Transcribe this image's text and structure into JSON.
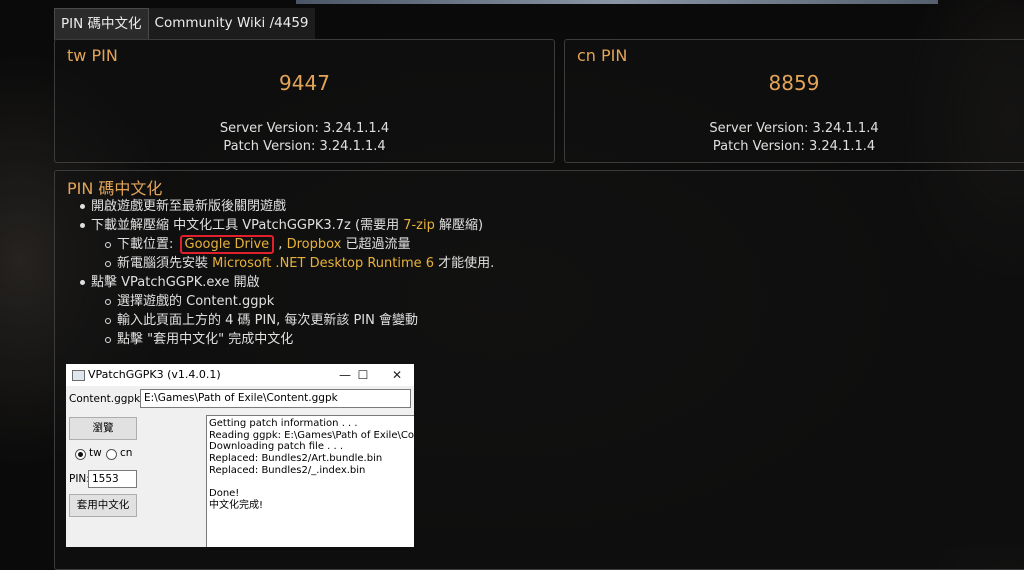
{
  "tabs": [
    {
      "label": "PIN 碼中文化"
    },
    {
      "label": "Community Wiki /4459"
    }
  ],
  "pin_cards": [
    {
      "title": "tw PIN",
      "pin": "9447",
      "server_version": "Server Version: 3.24.1.1.4",
      "patch_version": "Patch Version: 3.24.1.1.4"
    },
    {
      "title": "cn PIN",
      "pin": "8859",
      "server_version": "Server Version: 3.24.1.1.4",
      "patch_version": "Patch Version: 3.24.1.1.4"
    }
  ],
  "guide": {
    "title": "PIN 碼中文化",
    "step1": "開啟遊戲更新至最新版後關閉遊戲",
    "step2_pre": "下載並解壓縮 中文化工具 VPatchGGPK3.7z (需要用 ",
    "step2_link": "7-zip",
    "step2_post": " 解壓縮)",
    "dl_pre": "下載位置: ",
    "dl_link1": "Google Drive",
    "dl_sep": " , ",
    "dl_link2": "Dropbox",
    "dl_post": " 已超過流量",
    "net_pre": "新電腦須先安裝 ",
    "net_link": "Microsoft .NET Desktop Runtime 6",
    "net_post": " 才能使用.",
    "step3": "點擊 VPatchGGPK.exe 開啟",
    "sub1": "選擇遊戲的 Content.ggpk",
    "sub2": "輸入此頁面上方的 4 碼 PIN, 每次更新該 PIN 會變動",
    "sub3": "點擊 \"套用中文化\" 完成中文化"
  },
  "window": {
    "title": "VPatchGGPK3 (v1.4.0.1)",
    "minimize": "—",
    "maximize": "☐",
    "close": "✕",
    "content_label": "Content.ggpk:",
    "content_value": "E:\\Games\\Path of Exile\\Content.ggpk",
    "browse_button": "瀏覽",
    "radio_tw": "tw",
    "radio_cn": "cn",
    "pin_label": "PIN:",
    "pin_value": "1553",
    "apply_button": "套用中文化",
    "log": [
      "Getting patch information . . .",
      "Reading ggpk: E:\\Games\\Path of Exile\\Content.ggpk",
      "Downloading patch file . . .",
      "Replaced: Bundles2/Art.bundle.bin",
      "Replaced: Bundles2/_.index.bin",
      "",
      "Done!",
      "中文化完成!"
    ]
  },
  "colors": {
    "accent": "#e3a458",
    "link": "#e8b23a",
    "highlight_box": "#e0202a"
  }
}
